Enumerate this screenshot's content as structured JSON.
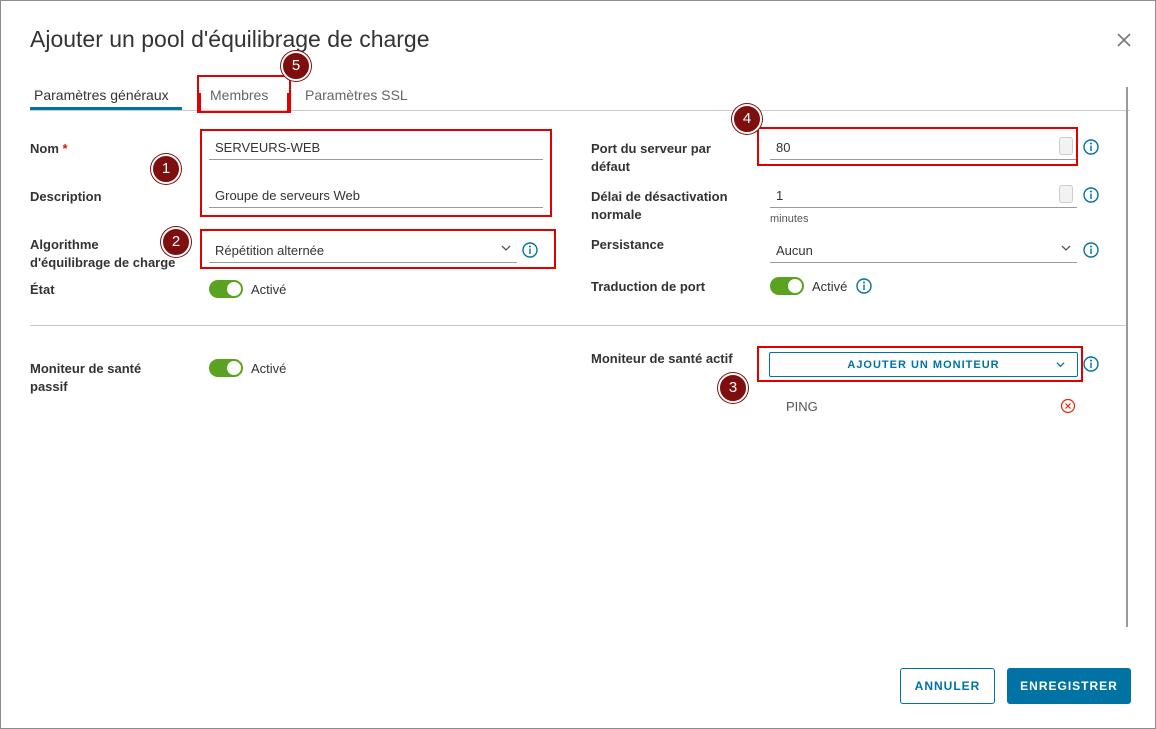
{
  "dialog": {
    "title": "Ajouter un pool d'équilibrage de charge",
    "close_icon": "close-icon"
  },
  "tabs": [
    {
      "label": "Paramètres généraux",
      "active": true
    },
    {
      "label": "Membres",
      "active": false
    },
    {
      "label": "Paramètres SSL",
      "active": false
    }
  ],
  "form": {
    "name": {
      "label": "Nom",
      "required_mark": "*",
      "value": "SERVEURS-WEB"
    },
    "description": {
      "label": "Description",
      "value": "Groupe de serveurs Web"
    },
    "algorithm": {
      "label_line1": "Algorithme",
      "label_line2": "d'équilibrage de charge",
      "value": "Répétition alternée"
    },
    "state": {
      "label": "État",
      "toggle_label": "Activé",
      "on": true
    },
    "port": {
      "label_line1": "Port du serveur par",
      "label_line2": "défaut",
      "value": "80"
    },
    "graceful_timeout": {
      "label_line1": "Délai de désactivation",
      "label_line2": "normale",
      "value": "1",
      "unit": "minutes"
    },
    "persistence": {
      "label": "Persistance",
      "value": "Aucun"
    },
    "port_translation": {
      "label": "Traduction de port",
      "toggle_label": "Activé",
      "on": true
    },
    "passive_monitor": {
      "label_line1": "Moniteur de santé",
      "label_line2": "passif",
      "toggle_label": "Activé",
      "on": true
    },
    "active_monitor": {
      "label": "Moniteur de santé actif",
      "button_label": "AJOUTER UN MONITEUR",
      "items": [
        "PING"
      ]
    }
  },
  "annotations": [
    "1",
    "2",
    "3",
    "4",
    "5"
  ],
  "footer": {
    "cancel_label": "ANNULER",
    "save_label": "ENREGISTRER"
  },
  "colors": {
    "accent": "#0072a3",
    "toggle_on": "#5aa220",
    "highlight": "#e00000",
    "badge": "#7f0e0e",
    "error": "#c92100"
  }
}
